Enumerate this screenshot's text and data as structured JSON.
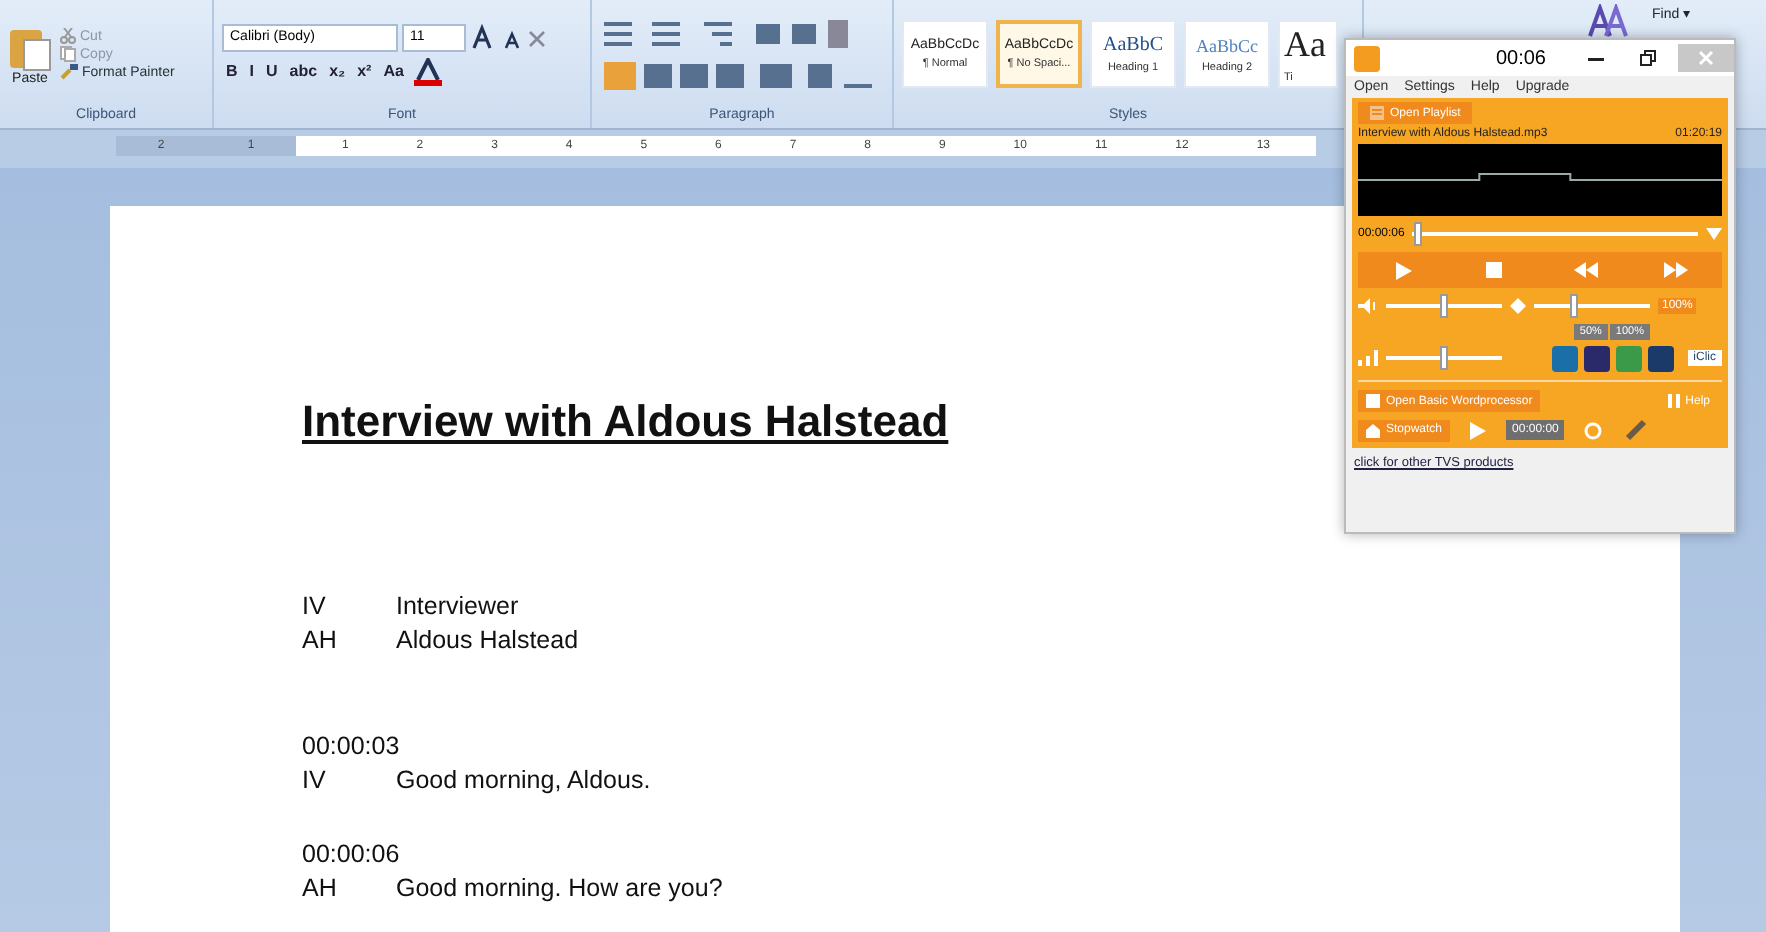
{
  "ribbon": {
    "clipboard": {
      "paste": "Paste",
      "cut": "Cut",
      "copy": "Copy",
      "format_painter": "Format Painter",
      "label": "Clipboard"
    },
    "font": {
      "name": "Calibri (Body)",
      "size": "11",
      "buttons": [
        "B",
        "I",
        "U",
        "abc",
        "x₂",
        "x²",
        "Aa"
      ],
      "label": "Font"
    },
    "paragraph": {
      "label": "Paragraph"
    },
    "styles": {
      "label": "Styles",
      "items": [
        {
          "preview": "AaBbCcDc",
          "name": "¶ Normal",
          "kind": "normal",
          "selected": false
        },
        {
          "preview": "AaBbCcDc",
          "name": "¶ No Spaci...",
          "kind": "normal",
          "selected": true
        },
        {
          "preview": "AaBbC",
          "name": "Heading 1",
          "kind": "heading",
          "selected": false
        },
        {
          "preview": "AaBbCc",
          "name": "Heading 2",
          "kind": "heading2",
          "selected": false
        },
        {
          "preview": "Aa",
          "name": "Ti",
          "kind": "title",
          "selected": false
        }
      ]
    },
    "find": "Find ▾"
  },
  "ruler": {
    "left_numbers": [
      "2",
      "1"
    ],
    "numbers": [
      "1",
      "2",
      "3",
      "4",
      "5",
      "6",
      "7",
      "8",
      "9",
      "10",
      "11",
      "12",
      "13"
    ]
  },
  "document": {
    "title": "Interview with Aldous Halstead",
    "speakers": [
      {
        "code": "IV",
        "name": "Interviewer"
      },
      {
        "code": "AH",
        "name": "Aldous Halstead"
      }
    ],
    "entries": [
      {
        "time": "00:00:03",
        "speaker": "IV",
        "text": "Good morning, Aldous."
      },
      {
        "time": "00:00:06",
        "speaker": "AH",
        "text": "Good morning.  How are you?"
      }
    ]
  },
  "player": {
    "title": "00:06",
    "menu": [
      "Open",
      "Settings",
      "Help",
      "Upgrade"
    ],
    "open_playlist": "Open Playlist",
    "file": "Interview with Aldous Halstead.mp3",
    "duration": "01:20:19",
    "position": {
      "time": "00:00:06",
      "level": 0.02
    },
    "volume": {
      "level": 0.5
    },
    "speed": {
      "level": 0.35,
      "reading": "100%",
      "presets": [
        "50%",
        "100%"
      ]
    },
    "balance": {
      "level": 0.5
    },
    "clic": "iClic",
    "open_wp": "Open Basic Wordprocessor",
    "help": "Help",
    "stopwatch": "Stopwatch",
    "stopwatch_time": "00:00:00",
    "link": "click for other TVS products"
  }
}
